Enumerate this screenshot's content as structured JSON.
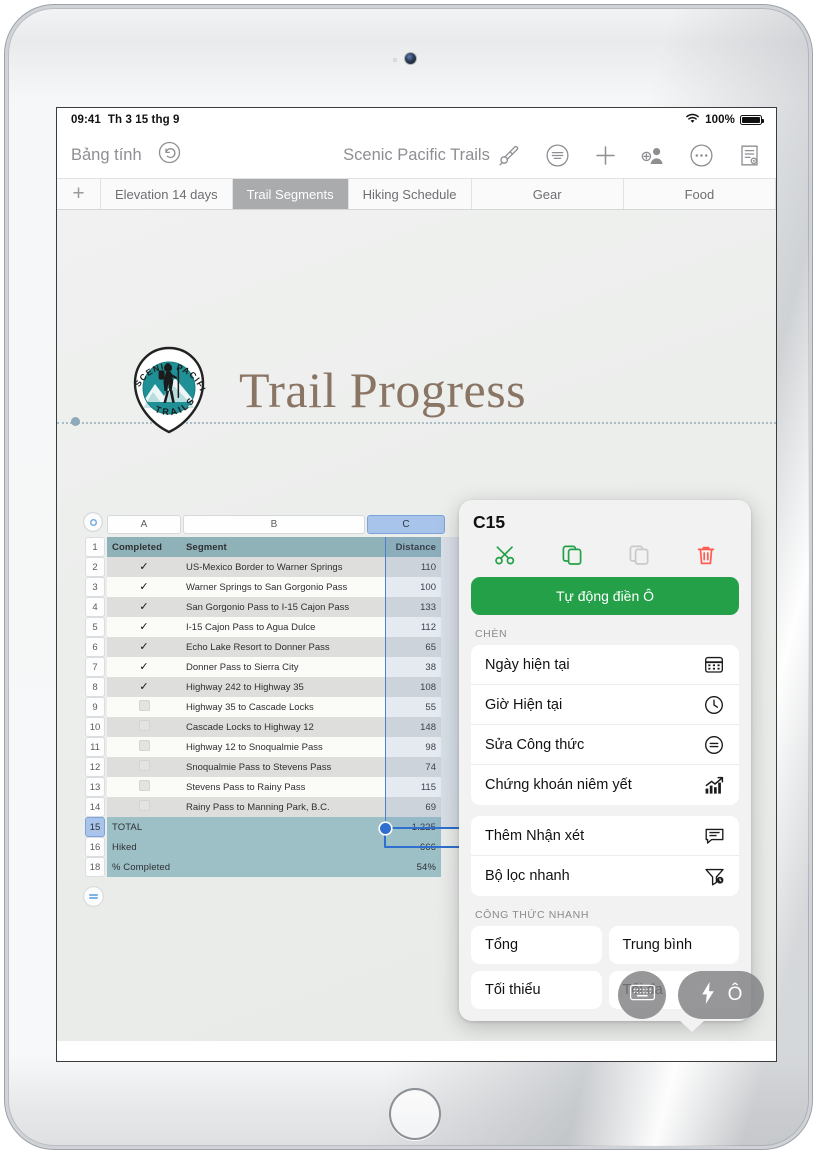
{
  "status_bar": {
    "time": "09:41",
    "date": "Th 3 15 thg 9",
    "wifi_icon": "wifi-icon",
    "battery_percent": "100%",
    "battery_icon": "battery-full-icon"
  },
  "toolbar": {
    "back_label": "Bảng tính",
    "undo_icon": "undo-icon",
    "document_title": "Scenic Pacific Trails",
    "icons": [
      {
        "name": "format-brush-icon",
        "label": "Định dạng"
      },
      {
        "name": "insert-menu-icon",
        "label": "Chèn"
      },
      {
        "name": "plus-icon",
        "label": "Thêm"
      },
      {
        "name": "collaborate-icon",
        "label": "Cộng tác"
      },
      {
        "name": "more-icon",
        "label": "Thêm nữa"
      },
      {
        "name": "document-options-icon",
        "label": "Tùy chọn tài liệu"
      }
    ]
  },
  "tabbar": {
    "add_icon": "plus-icon",
    "tabs": [
      {
        "label": "Elevation 14 days",
        "active": false
      },
      {
        "label": "Trail Segments",
        "active": true
      },
      {
        "label": "Hiking Schedule",
        "active": false
      },
      {
        "label": "Gear",
        "active": false
      },
      {
        "label": "Food",
        "active": false
      }
    ]
  },
  "canvas": {
    "logo": {
      "name": "scenic-pacific-trails-logo",
      "top_arc_left": "SCENIC",
      "top_arc_right": "PACIFIC",
      "bottom_text": "TRAILS",
      "color": "#1f9196"
    },
    "title": "Trail Progress"
  },
  "sheet": {
    "columns": [
      "A",
      "B",
      "C"
    ],
    "selected_column": "C",
    "headers": [
      "Completed",
      "Segment",
      "Distance"
    ],
    "row_numbers": [
      "1",
      "2",
      "3",
      "4",
      "5",
      "6",
      "7",
      "8",
      "9",
      "10",
      "11",
      "12",
      "13",
      "14",
      "15",
      "16",
      "18"
    ],
    "selected_row": "15",
    "rows": [
      {
        "completed": true,
        "segment": "US-Mexico Border to Warner Springs",
        "distance": "110"
      },
      {
        "completed": true,
        "segment": "Warner Springs to San Gorgonio Pass",
        "distance": "100"
      },
      {
        "completed": true,
        "segment": "San Gorgonio Pass to I-15 Cajon Pass",
        "distance": "133"
      },
      {
        "completed": true,
        "segment": "I-15 Cajon Pass to Agua Dulce",
        "distance": "112"
      },
      {
        "completed": true,
        "segment": "Echo Lake Resort to Donner Pass",
        "distance": "65"
      },
      {
        "completed": true,
        "segment": "Donner Pass to Sierra City",
        "distance": "38"
      },
      {
        "completed": true,
        "segment": "Highway 242 to Highway 35",
        "distance": "108"
      },
      {
        "completed": false,
        "segment": "Highway 35 to Cascade Locks",
        "distance": "55"
      },
      {
        "completed": false,
        "segment": "Cascade Locks to Highway 12",
        "distance": "148"
      },
      {
        "completed": false,
        "segment": "Highway 12 to Snoqualmie Pass",
        "distance": "98"
      },
      {
        "completed": false,
        "segment": "Snoqualmie Pass to Stevens Pass",
        "distance": "74"
      },
      {
        "completed": false,
        "segment": "Stevens Pass to Rainy Pass",
        "distance": "115"
      },
      {
        "completed": false,
        "segment": "Rainy Pass to Manning Park, B.C.",
        "distance": "69"
      }
    ],
    "summary_rows": [
      {
        "label": "TOTAL",
        "value": "1.225"
      },
      {
        "label": "Hiked",
        "value": "666"
      },
      {
        "label": "% Completed",
        "value": "54%"
      }
    ],
    "colors": {
      "header_fill": "#8fb2b8",
      "summary_fill": "#9cc0c6",
      "selection": "#2f6fd0",
      "column_header_selected": "#a8c4ea"
    }
  },
  "popover": {
    "cell_reference": "C15",
    "actions": [
      {
        "name": "cut-icon",
        "label": "Cắt",
        "color": "#24a148",
        "enabled": true
      },
      {
        "name": "copy-icon",
        "label": "Sao chép",
        "color": "#24a148",
        "enabled": true
      },
      {
        "name": "paste-icon",
        "label": "Dán",
        "color": "#c9c9cb",
        "enabled": false
      },
      {
        "name": "trash-icon",
        "label": "Xóa",
        "color": "#ff5b52",
        "enabled": true
      }
    ],
    "autofill_label": "Tự động điền Ô",
    "insert_section_label": "CHÈN",
    "insert_items": [
      {
        "label": "Ngày hiện tại",
        "icon": "calendar-icon"
      },
      {
        "label": "Giờ Hiện tại",
        "icon": "clock-icon"
      },
      {
        "label": "Sửa Công thức",
        "icon": "formula-icon"
      },
      {
        "label": "Chứng khoán niêm yết",
        "icon": "stock-chart-icon"
      }
    ],
    "extra_items": [
      {
        "label": "Thêm Nhận xét",
        "icon": "comment-icon"
      },
      {
        "label": "Bộ lọc nhanh",
        "icon": "filter-icon"
      }
    ],
    "quick_formula_label": "CÔNG THỨC NHANH",
    "quick_formulas": [
      "Tổng",
      "Trung bình",
      "Tối thiểu",
      "Tối đa"
    ]
  },
  "floating_controls": {
    "keyboard_icon": "keyboard-icon",
    "formula_icon": "lightning-icon",
    "cell_icon": "Ô"
  }
}
